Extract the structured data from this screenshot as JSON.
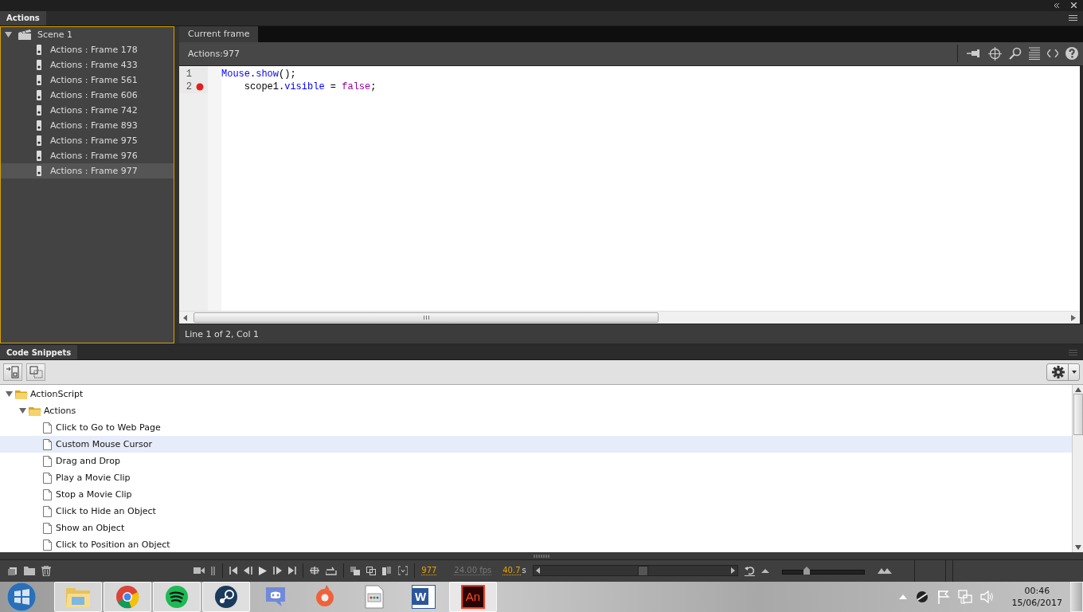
{
  "panel_tab": "Actions",
  "script_tree": {
    "label": "Scene 1",
    "expanded": true,
    "children": [
      {
        "label": "Actions : Frame 178",
        "selected": false
      },
      {
        "label": "Actions : Frame 433",
        "selected": false
      },
      {
        "label": "Actions : Frame 561",
        "selected": false
      },
      {
        "label": "Actions : Frame 606",
        "selected": false
      },
      {
        "label": "Actions : Frame 742",
        "selected": false
      },
      {
        "label": "Actions : Frame 893",
        "selected": false
      },
      {
        "label": "Actions : Frame 975",
        "selected": false
      },
      {
        "label": "Actions : Frame 976",
        "selected": false
      },
      {
        "label": "Actions : Frame 977",
        "selected": true
      }
    ]
  },
  "editor": {
    "tab": "Current frame",
    "location": "Actions:977",
    "lines": [
      {
        "number": "1",
        "breakpoint": false,
        "tokens": [
          {
            "text": "Mouse",
            "kind": "builtin"
          },
          {
            "text": ".",
            "kind": "plain"
          },
          {
            "text": "show",
            "kind": "builtin"
          },
          {
            "text": "();",
            "kind": "plain"
          }
        ]
      },
      {
        "number": "2",
        "breakpoint": true,
        "tokens": [
          {
            "text": "    scope1.",
            "kind": "plain"
          },
          {
            "text": "visible",
            "kind": "builtin"
          },
          {
            "text": " = ",
            "kind": "plain"
          },
          {
            "text": "false",
            "kind": "literal"
          },
          {
            "text": ";",
            "kind": "plain"
          }
        ]
      }
    ],
    "status": "Line 1 of 2, Col 1"
  },
  "snippets": {
    "tab": "Code Snippets",
    "tree": [
      {
        "label": "ActionScript",
        "expanded": true,
        "children": [
          {
            "label": "Actions",
            "expanded": true,
            "children": [
              {
                "label": "Click to Go to Web Page",
                "selected": false
              },
              {
                "label": "Custom Mouse Cursor",
                "selected": true
              },
              {
                "label": "Drag and Drop",
                "selected": false
              },
              {
                "label": "Play a Movie Clip",
                "selected": false
              },
              {
                "label": "Stop a Movie Clip",
                "selected": false
              },
              {
                "label": "Click to Hide an Object",
                "selected": false
              },
              {
                "label": "Show an Object",
                "selected": false
              },
              {
                "label": "Click to Position an Object",
                "selected": false
              }
            ]
          }
        ]
      }
    ]
  },
  "timeline": {
    "frame": "977",
    "fps": "24.00 fps",
    "time": "40.7",
    "time_unit": "s",
    "zoom": {
      "level": 0.3
    }
  },
  "taskbar": {
    "apps": [
      {
        "kind": "folder",
        "running": true
      },
      {
        "kind": "browser",
        "running": true
      },
      {
        "kind": "music",
        "running": true
      },
      {
        "kind": "steam",
        "running": true
      },
      {
        "kind": "chat",
        "running": false
      },
      {
        "kind": "origin",
        "running": false
      },
      {
        "kind": "document",
        "running": false
      },
      {
        "kind": "word",
        "running": false,
        "label": "W"
      },
      {
        "kind": "animate",
        "running": true,
        "label": "An"
      }
    ],
    "time": "00:46",
    "date": "15/06/2017"
  }
}
